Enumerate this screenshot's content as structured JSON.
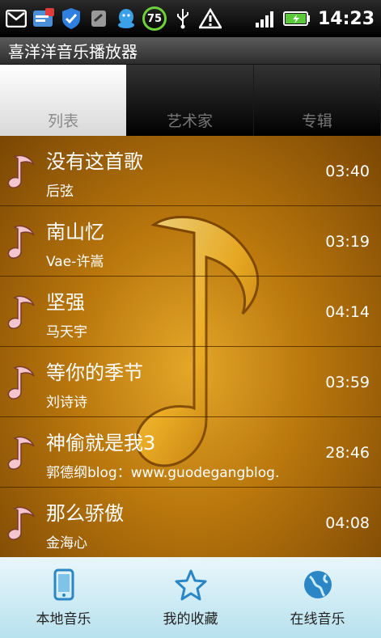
{
  "status_bar": {
    "battery_badge": "75",
    "clock": "14:23",
    "icons": [
      "mail-icon",
      "notification-icon",
      "shield-icon",
      "phone-icon",
      "qq-icon",
      "battery-percent-badge",
      "usb-icon",
      "warning-icon",
      "signal-icon",
      "battery-icon"
    ]
  },
  "app": {
    "title": "喜洋洋音乐播放器"
  },
  "tabs": [
    {
      "label": "列表",
      "active": true
    },
    {
      "label": "艺术家",
      "active": false
    },
    {
      "label": "专辑",
      "active": false
    }
  ],
  "songs": [
    {
      "title": "没有这首歌",
      "artist": "后弦",
      "duration": "03:40"
    },
    {
      "title": "南山忆",
      "artist": "Vae-许嵩",
      "duration": "03:19"
    },
    {
      "title": "坚强",
      "artist": "马天宇",
      "duration": "04:14"
    },
    {
      "title": "等你的季节",
      "artist": "刘诗诗",
      "duration": "03:59"
    },
    {
      "title": "神偷就是我3",
      "artist": "郭德纲blog：www.guodegangblog.",
      "duration": "28:46"
    },
    {
      "title": "那么骄傲",
      "artist": "金海心",
      "duration": "04:08"
    }
  ],
  "bottom_nav": [
    {
      "label": "本地音乐",
      "icon": "phone-device-icon"
    },
    {
      "label": "我的收藏",
      "icon": "star-icon"
    },
    {
      "label": "在线音乐",
      "icon": "globe-icon"
    }
  ],
  "colors": {
    "list_bg": "#b8760c",
    "bottom_nav_bg": "#cdebf5",
    "note_pink": "#f3c6cf"
  }
}
